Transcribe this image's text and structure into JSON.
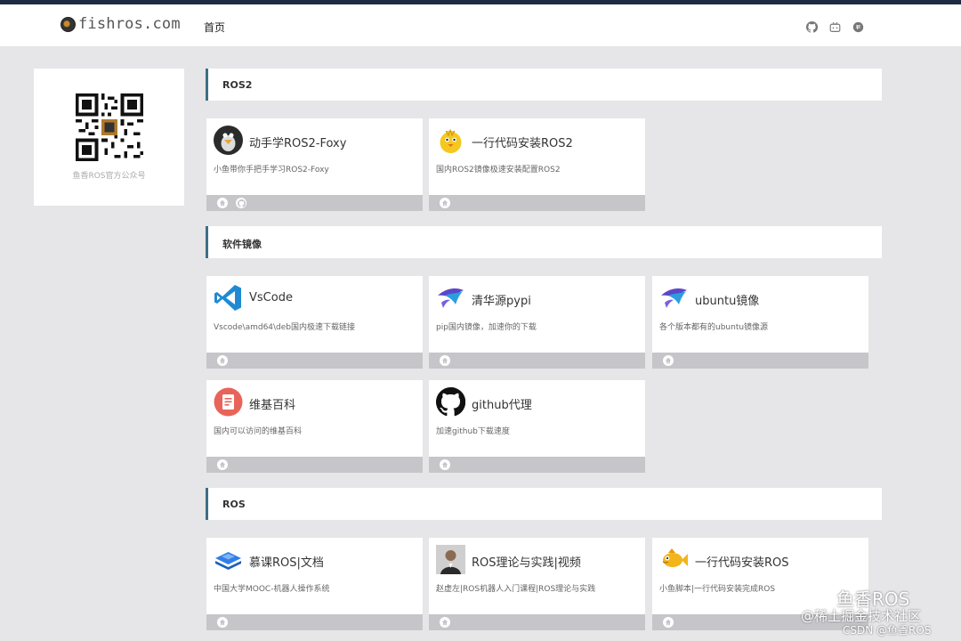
{
  "header": {
    "logo_text": "fishros.com",
    "nav": {
      "home": "首页"
    },
    "icons": [
      "github-icon",
      "bilibili-icon",
      "zhihu-icon"
    ]
  },
  "sidebar": {
    "qr_caption": "鱼香ROS官方公众号"
  },
  "sections": [
    {
      "title": "ROS2",
      "cards": [
        {
          "title": "动手学ROS2-Foxy",
          "desc": "小鱼带你手把手学习ROS2-Foxy",
          "icon": "penguin-avatar-icon",
          "links": [
            "home-icon",
            "github-icon"
          ]
        },
        {
          "title": "一行代码安装ROS2",
          "desc": "国内ROS2镜像极速安装配置ROS2",
          "icon": "chick-icon",
          "links": [
            "home-icon"
          ]
        }
      ]
    },
    {
      "title": "软件镜像",
      "cards": [
        {
          "title": "VsCode",
          "desc": "Vscode\\amd64\\deb国内极速下载链接",
          "icon": "vscode-icon",
          "links": [
            "home-icon"
          ]
        },
        {
          "title": "清华源pypi",
          "desc": "pip国内镜像，加速你的下载",
          "icon": "tuna-icon",
          "links": [
            "home-icon"
          ]
        },
        {
          "title": "ubuntu镜像",
          "desc": "各个版本都有的ubuntu镜像源",
          "icon": "tuna-icon",
          "links": [
            "home-icon"
          ]
        },
        {
          "title": "维基百科",
          "desc": "国内可以访问的维基百科",
          "icon": "wiki-icon",
          "links": [
            "home-icon"
          ]
        },
        {
          "title": "github代理",
          "desc": "加速github下载速度",
          "icon": "github-cat-icon",
          "links": [
            "home-icon"
          ]
        }
      ]
    },
    {
      "title": "ROS",
      "cards": [
        {
          "title": "慕课ROS|文档",
          "desc": "中国大学MOOC-机器人操作系统",
          "icon": "stack-icon",
          "links": [
            "home-icon"
          ]
        },
        {
          "title": "ROS理论与实践|视频",
          "desc": "赵虚左|ROS机器人入门课程|ROS理论与实践",
          "icon": "person-photo-icon",
          "links": [
            "home-icon"
          ]
        },
        {
          "title": "一行代码安装ROS",
          "desc": "小鱼脚本|一行代码安装完成ROS",
          "icon": "fish-icon",
          "links": [
            "home-icon"
          ]
        }
      ]
    }
  ],
  "watermark": {
    "line1": "鱼香ROS",
    "line2": "@稀土掘金技术社区",
    "line3": "CSDN @鱼香ROS"
  },
  "colors": {
    "accent": "#3d6f86",
    "footer_bar": "#c6c5ca",
    "topstripe": "#1f2a44",
    "background": "#e6e5e8"
  }
}
